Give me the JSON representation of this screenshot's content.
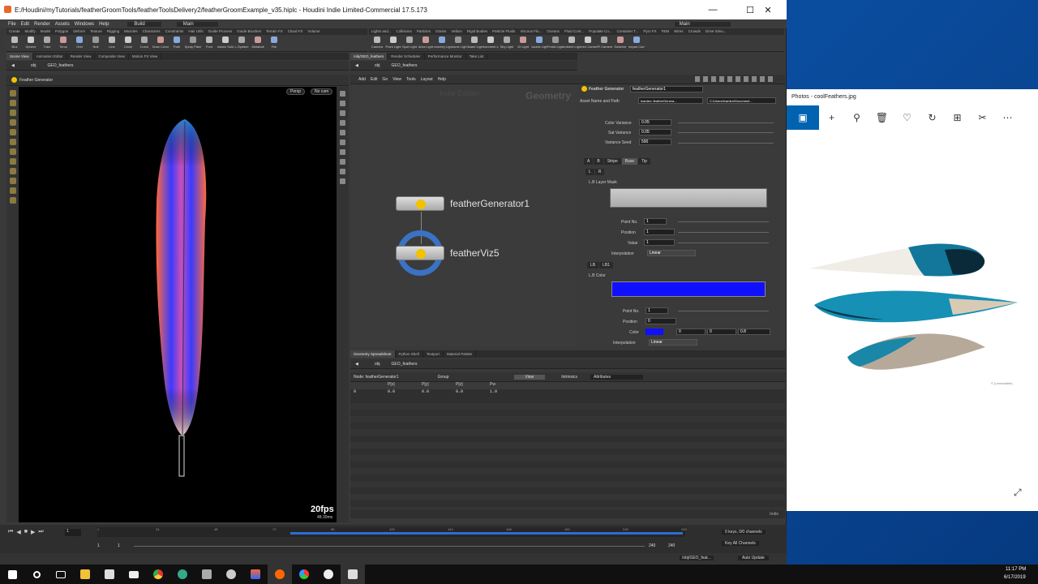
{
  "houdini": {
    "title": "E:/Houdini/myTutorials/featherGroomTools/featherToolsDelivery2/featherGroomExample_v35.hiplc - Houdini Indie Limited-Commercial 17.5.173",
    "menu": [
      "File",
      "Edit",
      "Render",
      "Assets",
      "Windows",
      "Help"
    ],
    "build": "Build",
    "desktop": "Main",
    "desktop_right": "Main",
    "shelf_left_tabs": [
      "Create",
      "Modify",
      "Model",
      "Polygon",
      "Deform",
      "Texture",
      "Rigging",
      "Muscles",
      "Characters",
      "Constraints",
      "Hair Utils",
      "Guide Process",
      "Guide Brushes",
      "Terrain FX",
      "Cloud FX",
      "Volume"
    ],
    "shelf_left_tools": [
      "Box",
      "Sphere",
      "Tube",
      "Torus",
      "Grid",
      "Null",
      "Line",
      "Circle",
      "Curve",
      "Draw Curve",
      "Path",
      "Spray Paint",
      "Font",
      "Platonic Solids",
      "L-System",
      "Metaball",
      "File"
    ],
    "shelf_right_tabs": [
      "Lights and...",
      "Collisions",
      "Particles",
      "Grains",
      "Vellum",
      "Rigid Bodies",
      "Particle Fluids",
      "Viscous Flu...",
      "Oceans",
      "Fluid Cont...",
      "Populate Co...",
      "Container T...",
      "Pyro FX",
      "FEM",
      "Wires",
      "Crowds",
      "Drive Simu..."
    ],
    "shelf_right_tools": [
      "Camera",
      "Point Light",
      "Spot Light",
      "Area Light",
      "Geometry Light",
      "Volume Light",
      "Distant Light",
      "Environment Light",
      "Sky Light",
      "GI Light",
      "Caustic Light",
      "Portal Light",
      "Ambient Light",
      "Stereo Camera",
      "VR Camera",
      "Switcher",
      "Gamepad Camera"
    ],
    "left_pane_tabs": [
      "Scene View",
      "Animation Editor",
      "Render View",
      "Composite View",
      "Motion FX View"
    ],
    "left_path": [
      "obj",
      "GEO_feathers"
    ],
    "viewport_header": "Feather Generator",
    "persp": "Persp",
    "nocam": "No cam",
    "fps": "20fps",
    "fps_time": "48.30ms",
    "net_tabs": [
      "/obj/GEO_feathers",
      "Render Scheduler",
      "Performance Monitor",
      "Take List"
    ],
    "net_path": [
      "obj",
      "GEO_feathers"
    ],
    "net_menu": [
      "Add",
      "Edit",
      "Go",
      "View",
      "Tools",
      "Layout",
      "Help"
    ],
    "watermark_edition": "Indie Edition",
    "watermark_geometry": "Geometry",
    "nodes": [
      "featherGenerator1",
      "featherViz5"
    ],
    "params": {
      "type_label": "Feather Generator",
      "node_name": "featherGenerator1",
      "asset_label": "Asset Name and Path",
      "asset_value": "tcarden::featherGenera...",
      "asset_path": "C:/Users/tcarden/Document...",
      "color_variance_label": "Color Variance",
      "color_variance": "0.05",
      "sat_variance_label": "Sat Variance",
      "sat_variance": "0.05",
      "variance_seed_label": "Variance Seed",
      "variance_seed": "500",
      "tabs": [
        "A",
        "B",
        "Stripe",
        "Base",
        "Tip"
      ],
      "subtabs": [
        "L",
        "R"
      ],
      "layer_mask_label": "L.B Layer Mask",
      "point_no_label": "Point No.",
      "point_no": "1",
      "position_label": "Position",
      "position": "1",
      "value_label": "Value",
      "value": "1",
      "interp_label": "Interpolation",
      "interp": "Linear",
      "lb_tabs": [
        "LB",
        "LB1"
      ],
      "color_label_section": "L.B Color",
      "point_no2": "1",
      "position2": "0",
      "color_label": "Color",
      "color_r": "0",
      "color_g": "0",
      "color_b": "0.8",
      "interp2": "Linear",
      "ramp_color": "#1010ff"
    },
    "sheet_tabs": [
      "Geometry Spreadsheet",
      "Python Shell",
      "Textport",
      "Material Palette"
    ],
    "sheet_path": [
      "obj",
      "GEO_feathers"
    ],
    "sheet_node_label": "Node: featherGenerator1",
    "sheet_group": "Group",
    "sheet_view": "View",
    "sheet_intrinsic": "Intrinsics",
    "sheet_attrs": "Attributes",
    "sheet_cols": [
      "",
      "P[x]",
      "P[y]",
      "P[z]",
      "Pw"
    ],
    "sheet_row": [
      "0",
      "0.0",
      "0.0",
      "0.0",
      "1.0"
    ],
    "indie_label": "Indie",
    "timeline_frame": "1",
    "timeline_ticks": [
      "1",
      "24",
      "48",
      "72",
      "96",
      "120",
      "144",
      "168",
      "192",
      "216",
      "240"
    ],
    "range_start": "1",
    "range_start2": "1",
    "range_end": "240",
    "range_end2": "240",
    "keys_label": "0 keys, 0/0 channels",
    "keyall_label": "Key All Channels",
    "status_path": "/obj/GEO_feat...",
    "auto_update": "Auto Update",
    "feather_colors": [
      "#3a3aff",
      "#ff6a3a",
      "#c84fb8",
      "#1f8ad4",
      "#e8d5c0"
    ]
  },
  "photos": {
    "title": "Photos - coolFeathers.jpg",
    "credit": "© (unreadable)",
    "tools": [
      "image-icon",
      "plus-icon",
      "zoom-icon",
      "delete-icon",
      "heart-icon",
      "rotate-icon",
      "crop-icon",
      "edit-icon",
      "more-icon"
    ]
  },
  "taskbar": {
    "time": "11:17 PM",
    "date": "6/17/2019"
  }
}
